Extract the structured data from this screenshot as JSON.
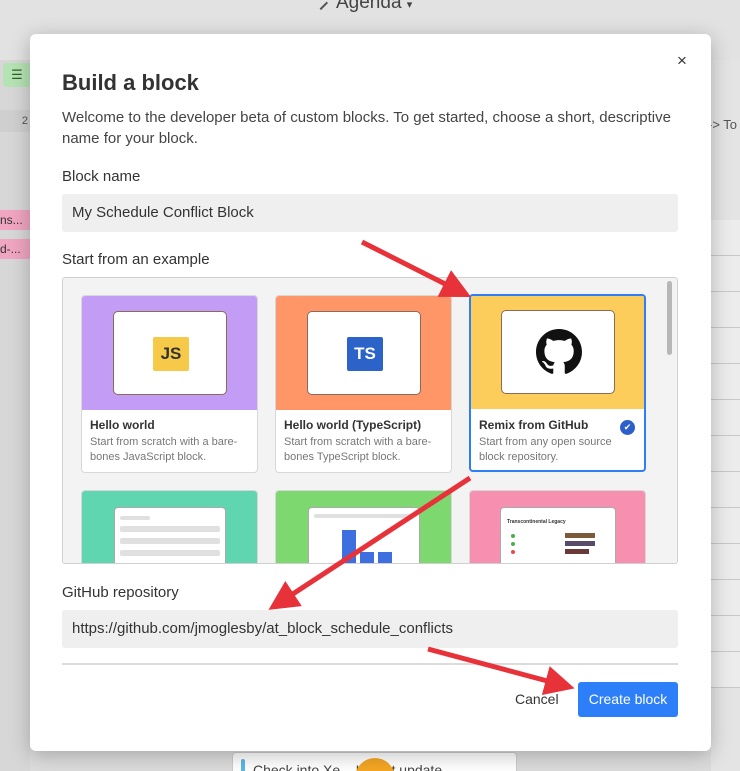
{
  "background": {
    "title": "Agenda",
    "row_number": "2",
    "pink_items": [
      "ns...",
      "d-..."
    ],
    "right_text": "-> To",
    "card_text": "Check into Xe... UITest update"
  },
  "modal": {
    "title": "Build a block",
    "description": "Welcome to the developer beta of custom blocks. To get started, choose a short, descriptive name for your block.",
    "block_name_label": "Block name",
    "block_name_value": "My Schedule Conflict Block",
    "examples_label": "Start from an example",
    "examples": [
      {
        "title": "Hello world",
        "desc": "Start from scratch with a bare-bones JavaScript block.",
        "badge": "JS",
        "color": "#c39cf5",
        "selected": false
      },
      {
        "title": "Hello world (TypeScript)",
        "desc": "Start from scratch with a bare-bones TypeScript block.",
        "badge": "TS",
        "color": "#ff9668",
        "selected": false
      },
      {
        "title": "Remix from GitHub",
        "desc": "Start from any open source block repository.",
        "icon": "github-icon",
        "color": "#fccd5a",
        "selected": true
      }
    ],
    "preview_title": "Transcontinental Legacy",
    "github_label": "GitHub repository",
    "github_value": "https://github.com/jmoglesby/at_block_schedule_conflicts",
    "cancel_label": "Cancel",
    "create_label": "Create block",
    "close_symbol": "×"
  },
  "colors": {
    "accent": "#2d7ff9",
    "arrow": "#e8323a",
    "js_badge": "#f7c948",
    "ts_badge": "#2b63c8"
  }
}
